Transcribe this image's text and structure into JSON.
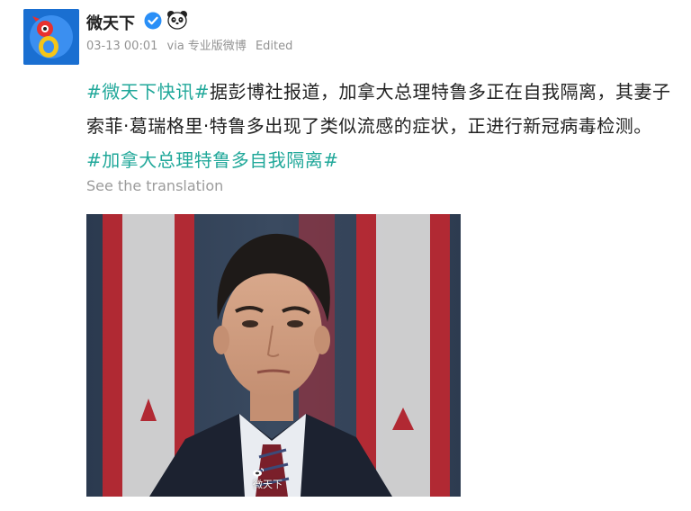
{
  "author": {
    "name": "微天下",
    "verified": true,
    "badge_icon": "verified-check-icon",
    "emoji_icon": "panda-icon"
  },
  "meta": {
    "timestamp": "03-13 00:01",
    "via_label": "via",
    "source": "专业版微博",
    "edited": "Edited"
  },
  "post": {
    "hashtag_open": "#微天下快讯#",
    "body": "据彭博社报道，加拿大总理特鲁多正在自我隔离，其妻子索菲·葛瑞格里·特鲁多出现了类似流感的症状，正进行新冠病毒检测。",
    "hashtag_close": "#加拿大总理特鲁多自我隔离#"
  },
  "translate": {
    "label": "See the translation"
  },
  "image": {
    "watermark_text": "微天下"
  },
  "colors": {
    "hashtag": "#21a89a",
    "brand_blue": "#1a6fd1",
    "meta_grey": "#939393"
  }
}
